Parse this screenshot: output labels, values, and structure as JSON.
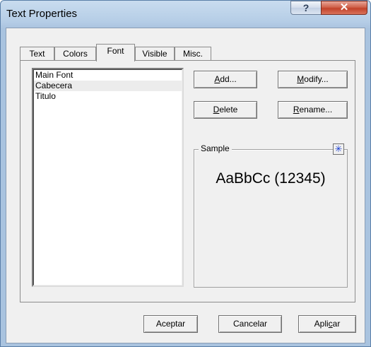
{
  "window": {
    "title": "Text Properties"
  },
  "titlebar": {
    "help_label": "?",
    "close_label": "✕"
  },
  "tabs": [
    {
      "label": "Text"
    },
    {
      "label": "Colors"
    },
    {
      "label": "Font",
      "selected": true
    },
    {
      "label": "Visible"
    },
    {
      "label": "Misc."
    }
  ],
  "font_list": {
    "items": [
      "Main Font",
      "Cabecera",
      "Titulo"
    ],
    "selected": "Cabecera"
  },
  "buttons": {
    "add": {
      "pre": "",
      "key": "A",
      "post": "dd..."
    },
    "modify": {
      "pre": "",
      "key": "M",
      "post": "odify..."
    },
    "delete": {
      "pre": "",
      "key": "D",
      "post": "elete"
    },
    "rename": {
      "pre": "",
      "key": "R",
      "post": "ename..."
    }
  },
  "sample": {
    "label": "Sample",
    "text": "AaBbCc (12345)",
    "icon": "asterisk-icon"
  },
  "dialog": {
    "ok_label": "Aceptar",
    "cancel_label": "Cancelar",
    "apply": {
      "pre": "Apli",
      "key": "c",
      "post": "ar"
    }
  },
  "colors": {
    "accent": "#1a3fcf",
    "close": "#c2432a"
  }
}
